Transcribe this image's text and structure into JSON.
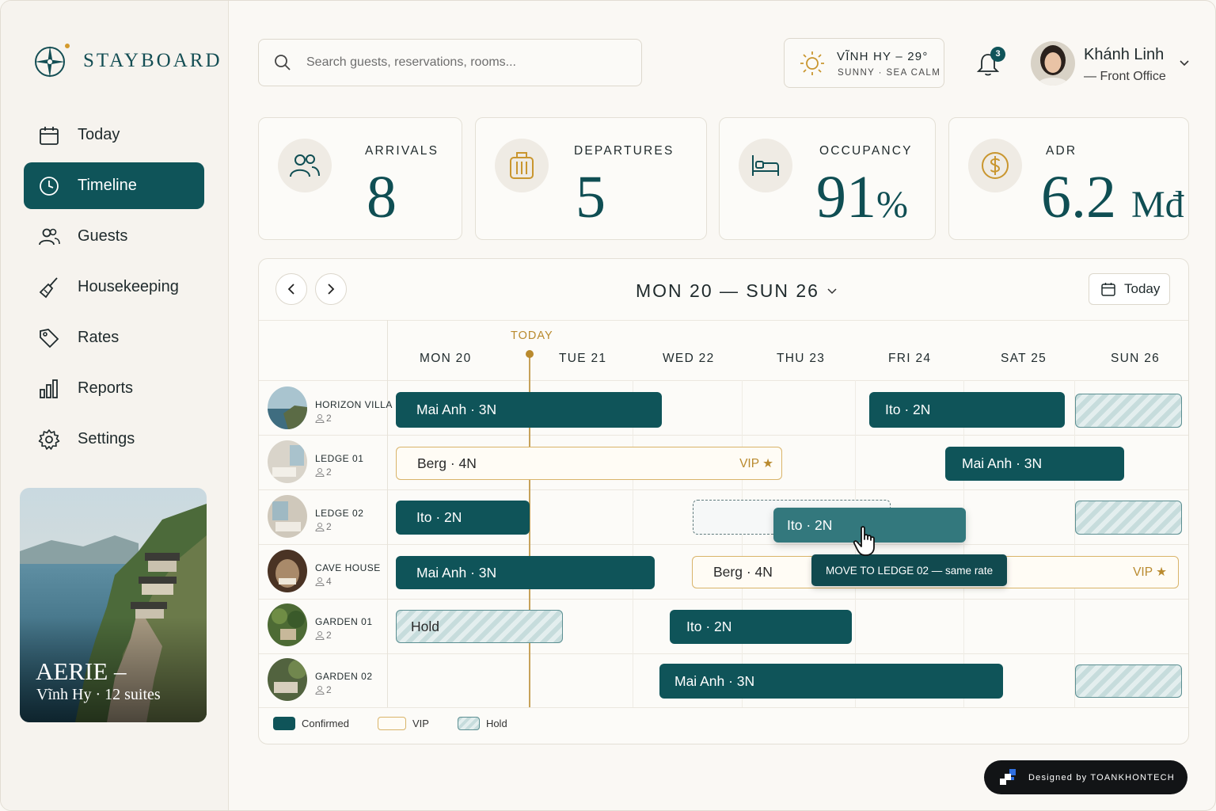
{
  "app": {
    "brand": "STAYBOARD"
  },
  "sidebar": {
    "items": [
      {
        "label": "Today",
        "icon": "calendar-icon"
      },
      {
        "label": "Timeline",
        "icon": "clock-icon",
        "active": true
      },
      {
        "label": "Guests",
        "icon": "users-icon"
      },
      {
        "label": "Housekeeping",
        "icon": "broom-icon"
      },
      {
        "label": "Rates",
        "icon": "tag-icon"
      },
      {
        "label": "Reports",
        "icon": "bar-chart-icon"
      },
      {
        "label": "Settings",
        "icon": "gear-icon"
      }
    ],
    "property": {
      "name": "AERIE –",
      "subtitle": "Vĩnh Hy · 12 suites"
    }
  },
  "header": {
    "search_placeholder": "Search guests, reservations, rooms...",
    "weather": {
      "title": "VĨNH HY – 29°",
      "subtitle": "SUNNY · SEA CALM"
    },
    "notifications": "3",
    "user": {
      "name": "Khánh Linh",
      "role": "— Front Office"
    }
  },
  "kpis": {
    "arrivals": {
      "label": "ARRIVALS",
      "value": "8"
    },
    "departures": {
      "label": "DEPARTURES",
      "value": "5"
    },
    "occupancy": {
      "label": "OCCUPANCY",
      "value": "91",
      "unit": "%"
    },
    "adr": {
      "label": "ADR",
      "value": "6.2",
      "unit": "Mđ"
    }
  },
  "timeline": {
    "range": "MON 20 — SUN 26",
    "today_button": "Today",
    "today_marker": "TODAY",
    "days": [
      "MON 20",
      "TUE 21",
      "WED 22",
      "THU 23",
      "FRI 24",
      "SAT 25",
      "SUN 26"
    ],
    "rooms": [
      {
        "name": "HORIZON VILLA",
        "capacity": "2"
      },
      {
        "name": "LEDGE 01",
        "capacity": "2"
      },
      {
        "name": "LEDGE 02",
        "capacity": "2"
      },
      {
        "name": "CAVE HOUSE",
        "capacity": "4"
      },
      {
        "name": "GARDEN 01",
        "capacity": "2"
      },
      {
        "name": "GARDEN 02",
        "capacity": "2"
      }
    ],
    "bookings": {
      "r0a": "Mai Anh · 3N",
      "r0b": "Ito · 2N",
      "r1a": "Berg · 4N",
      "r1a_tag": "VIP ★",
      "r1b": "Mai Anh · 3N",
      "r2a": "Ito · 2N",
      "r2drag": "Ito · 2N",
      "r3a": "Mai Anh · 3N",
      "r3b": "Berg · 4N",
      "r3b_tag": "VIP ★",
      "r4a": "Hold",
      "r4b": "Ito · 2N",
      "r5a": "Mai Anh · 3N"
    },
    "tooltip": "MOVE TO LEDGE 02 — same rate",
    "legend": {
      "confirmed": "Confirmed",
      "vip": "VIP",
      "hold": "Hold"
    }
  },
  "credit": "Designed by TOANKHONTECH",
  "colors": {
    "accent": "#0f5459",
    "gold": "#b98a2e",
    "background": "#faf8f4"
  }
}
